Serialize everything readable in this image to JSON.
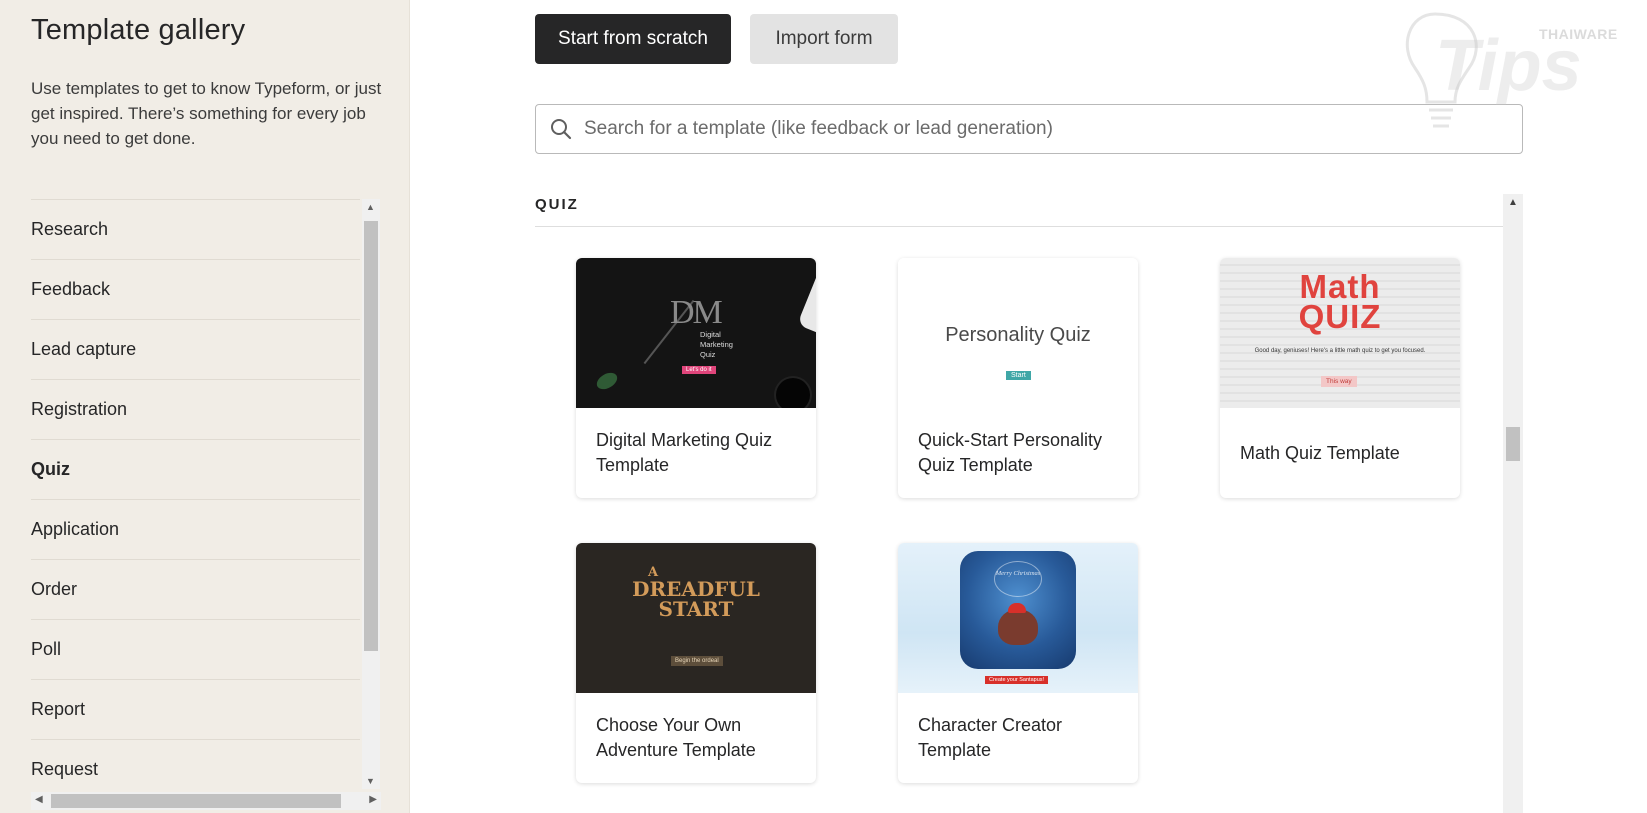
{
  "sidebar": {
    "title": "Template gallery",
    "intro": "Use templates to get to know Typeform, or just get inspired. There’s something for every job you need to get done.",
    "categories": [
      {
        "label": "Research",
        "active": false
      },
      {
        "label": "Feedback",
        "active": false
      },
      {
        "label": "Lead capture",
        "active": false
      },
      {
        "label": "Registration",
        "active": false
      },
      {
        "label": "Quiz",
        "active": true
      },
      {
        "label": "Application",
        "active": false
      },
      {
        "label": "Order",
        "active": false
      },
      {
        "label": "Poll",
        "active": false
      },
      {
        "label": "Report",
        "active": false
      },
      {
        "label": "Request",
        "active": false
      }
    ]
  },
  "toolbar": {
    "start_label": "Start from scratch",
    "import_label": "Import form"
  },
  "search": {
    "placeholder": "Search for a template (like feedback or lead generation)",
    "value": ""
  },
  "section": {
    "title": "QUIZ"
  },
  "templates": [
    {
      "title": "Digital Marketing Quiz Template",
      "thumb": {
        "logo": "DM",
        "heading": "Digital Marketing Quiz",
        "button": "Let's do it"
      }
    },
    {
      "title": "Quick-Start Personality Quiz Template",
      "thumb": {
        "heading": "Personality Quiz",
        "button": "Start"
      }
    },
    {
      "title": "Math Quiz Template",
      "thumb": {
        "heading_line1": "Math",
        "heading_line2": "QUIZ",
        "text": "Good day, geniuses! Here's a little math quiz to get you focused.",
        "button": "This way"
      }
    },
    {
      "title": "Choose Your Own Adventure Template",
      "thumb": {
        "heading_line1": "A",
        "heading_line2": "DREADFUL",
        "heading_line3": "START",
        "button": "Begin the ordeal"
      }
    },
    {
      "title": "Character Creator Template",
      "thumb": {
        "text": "Merry Christmas",
        "button": "Create your Santapus!"
      }
    }
  ],
  "watermark": {
    "brand": "THAIWARE",
    "word": "Tips"
  },
  "colors": {
    "sidebar_bg": "#f1ede6",
    "primary_button": "#262627",
    "secondary_button": "#e3e3e3",
    "math_red": "#e0433e",
    "dread_gold": "#d39b5a",
    "personality_teal": "#3fa7a7"
  }
}
